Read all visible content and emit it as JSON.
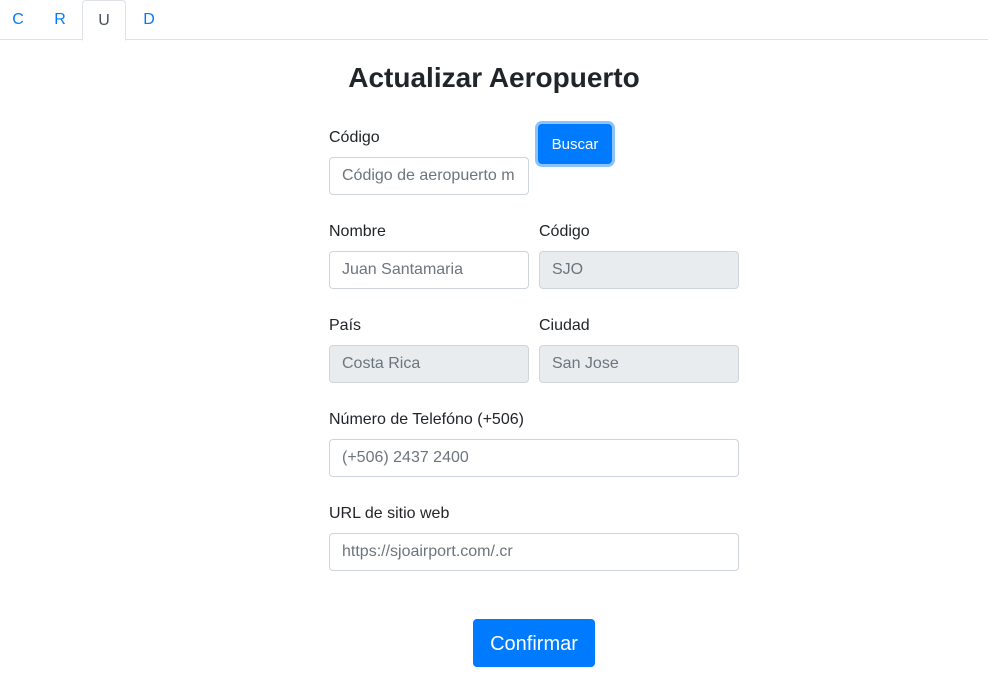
{
  "tabs": [
    "C",
    "R",
    "U",
    "D"
  ],
  "page": {
    "title": "Actualizar Aeropuerto"
  },
  "search": {
    "label": "Código",
    "placeholder": "Código de aeropuerto m",
    "button": "Buscar"
  },
  "form": {
    "nombre_label": "Nombre",
    "nombre_placeholder": "Juan Santamaria",
    "codigo_label": "Código",
    "codigo_placeholder": "SJO",
    "pais_label": "País",
    "pais_placeholder": "Costa Rica",
    "ciudad_label": "Ciudad",
    "ciudad_placeholder": "San Jose",
    "telefono_label": "Número de Telefóno (+506)",
    "telefono_placeholder": "(+506) 2437 2400",
    "url_label": "URL de sitio web",
    "url_placeholder": "https://sjoairport.com/.cr",
    "confirm_button": "Confirmar"
  },
  "colors": {
    "primary": "#007bff",
    "disabled_bg": "#e9ecef",
    "border": "#ced4da"
  }
}
